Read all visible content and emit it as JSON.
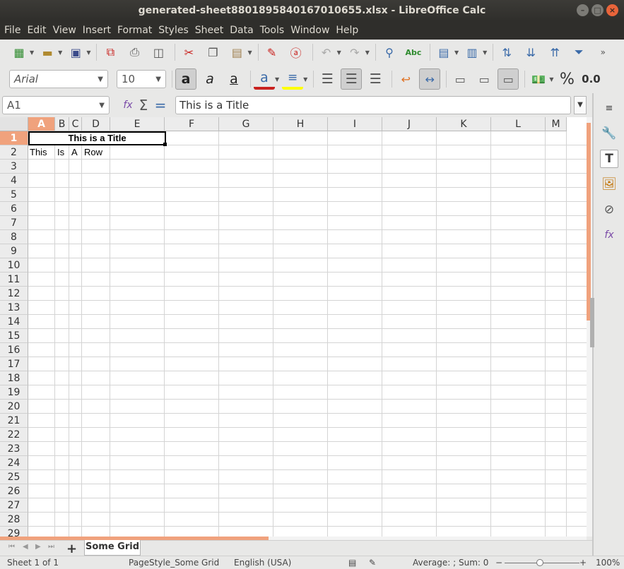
{
  "window": {
    "title": "generated-sheet8801895840167010655.xlsx - LibreOffice Calc"
  },
  "menu": [
    "File",
    "Edit",
    "View",
    "Insert",
    "Format",
    "Styles",
    "Sheet",
    "Data",
    "Tools",
    "Window",
    "Help"
  ],
  "font": {
    "name": "Arial",
    "size": "10"
  },
  "formula_bar": {
    "cell_ref": "A1",
    "content": "This is a Title"
  },
  "columns": [
    "A",
    "B",
    "C",
    "D",
    "E",
    "F",
    "G",
    "H",
    "I",
    "J",
    "K",
    "L",
    "M"
  ],
  "rows": [
    "1",
    "2",
    "3",
    "4",
    "5",
    "6",
    "7",
    "8",
    "9",
    "10",
    "11",
    "12",
    "13",
    "14",
    "15",
    "16",
    "17",
    "18",
    "19",
    "20",
    "21",
    "22",
    "23",
    "24",
    "25",
    "26",
    "27",
    "28",
    "29"
  ],
  "cells": {
    "A1": "This is a Title",
    "A2": "This",
    "B2": "Is",
    "C2": "A",
    "D2": "Row"
  },
  "sheet_tab": "Some Grid",
  "statusbar": {
    "sheet": "Sheet 1 of 1",
    "page_style": "PageStyle_Some Grid",
    "language": "English (USA)",
    "summary": "Average: ; Sum: 0",
    "zoom_minus": "−",
    "zoom_plus": "+",
    "zoom": "100%"
  },
  "toolbar": {
    "percent": "%",
    "decimal": "0.0"
  },
  "colors": {
    "accent": "#f0a27d",
    "font_color": "#c9211e",
    "highlight_color": "#ffff00"
  }
}
